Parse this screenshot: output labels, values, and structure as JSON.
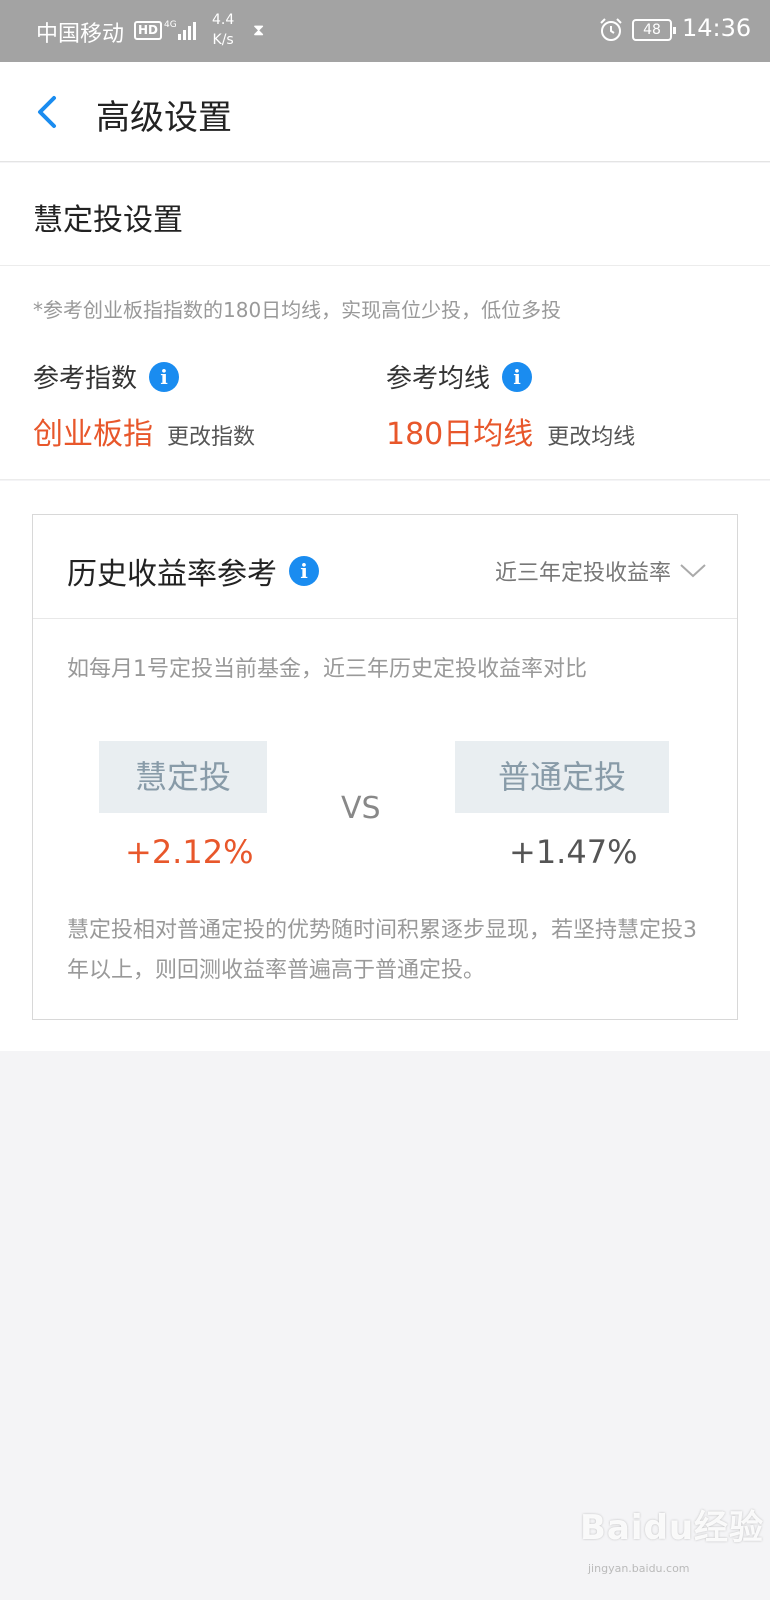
{
  "status_bar": {
    "carrier": "中国移动",
    "hd": "HD",
    "network_speed_value": "4.4",
    "network_speed_unit": "K/s",
    "battery": "48",
    "time": "14:36",
    "icons": [
      "hd-badge",
      "4g-signal-icon",
      "hourglass-icon",
      "alarm-icon",
      "battery-icon"
    ]
  },
  "nav": {
    "back_icon": "chevron-left-icon",
    "title": "高级设置"
  },
  "section": {
    "title": "慧定投设置"
  },
  "index_panel": {
    "hint": "*参考创业板指指数的180日均线，实现高位少投，低位多投",
    "reference_index": {
      "label": "参考指数",
      "value": "创业板指",
      "change_label": "更改指数"
    },
    "reference_ma": {
      "label": "参考均线",
      "value": "180日均线",
      "change_label": "更改均线"
    }
  },
  "history_card": {
    "title": "历史收益率参考",
    "period_selector": "近三年定投收益率",
    "description": "如每月1号定投当前基金，近三年历史定投收益率对比",
    "left_name": "慧定投",
    "left_rate": "+2.12%",
    "vs": "VS",
    "right_name": "普通定投",
    "right_rate": "+1.47%",
    "footnote": "慧定投相对普通定投的优势随时间积累逐步显现，若坚持慧定投3年以上，则回测收益率普遍高于普通定投。"
  },
  "watermark": {
    "brand": "Baidu经验",
    "url": "jingyan.baidu.com"
  },
  "colors": {
    "accent_orange": "#e8572b",
    "info_blue": "#1a8cf0",
    "status_bar_bg": "#a3a3a3"
  }
}
